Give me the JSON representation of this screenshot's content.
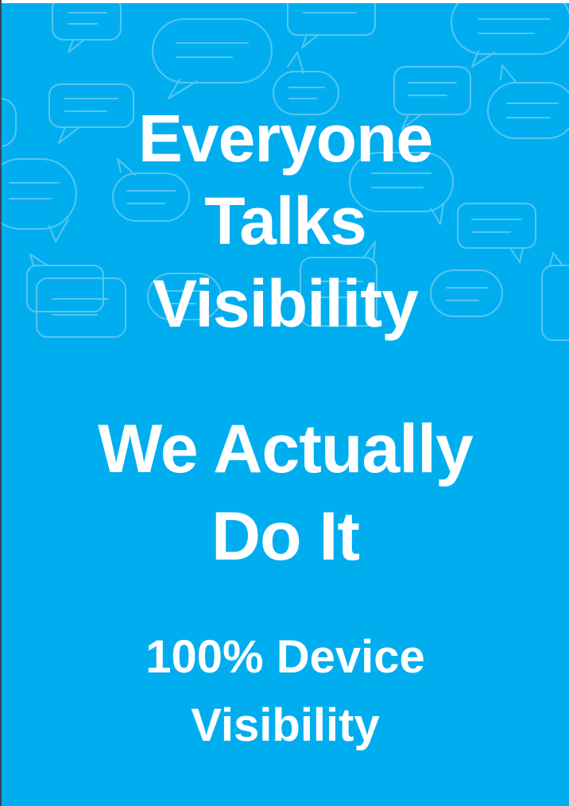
{
  "headline_top": {
    "line1": "Everyone",
    "line2": "Talks",
    "line3": "Visibility"
  },
  "headline_middle": {
    "line1": "We Actually",
    "line2": "Do It"
  },
  "headline_bottom": {
    "line1": "100% Device",
    "line2": "Visibility"
  },
  "colors": {
    "background": "#00aeef",
    "text": "#ffffff",
    "pattern_stroke": "#56c6f0"
  },
  "decoration": "speech-bubble-pattern"
}
